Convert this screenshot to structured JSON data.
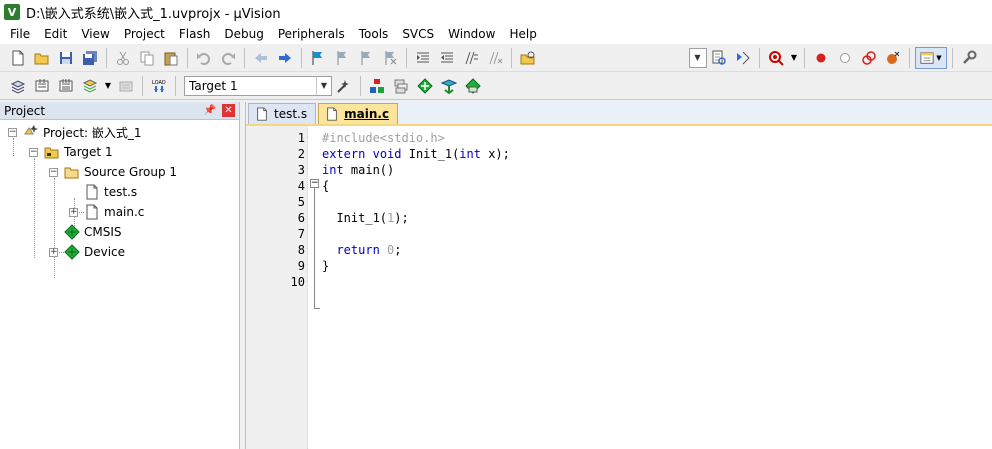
{
  "window": {
    "title": "D:\\嵌入式系统\\嵌入式_1.uvprojx - µVision"
  },
  "menu": [
    "File",
    "Edit",
    "View",
    "Project",
    "Flash",
    "Debug",
    "Peripherals",
    "Tools",
    "SVCS",
    "Window",
    "Help"
  ],
  "toolbar2": {
    "target_label": "Target 1"
  },
  "project_panel": {
    "title": "Project",
    "pin_icon": "pin-icon",
    "close_icon": "close-icon",
    "tree": {
      "root": "Project: 嵌入式_1",
      "target": "Target 1",
      "group": "Source Group 1",
      "file1": "test.s",
      "file2": "main.c",
      "cmsis": "CMSIS",
      "device": "Device"
    }
  },
  "editor": {
    "tabs": [
      {
        "label": "test.s",
        "active": false
      },
      {
        "label": "main.c",
        "active": true
      }
    ],
    "line_numbers": [
      "1",
      "2",
      "3",
      "4",
      "5",
      "6",
      "7",
      "8",
      "9",
      "10"
    ],
    "code": {
      "l1": "#include<stdio.h>",
      "l2_kw1": "extern",
      "l2_kw2": "void",
      "l2_fn": " Init_1(",
      "l2_kw3": "int",
      "l2_end": " x);",
      "l3_kw": "int",
      "l3_rest": " main()",
      "l4": "{",
      "l6_fn": "  Init_1(",
      "l6_num": "1",
      "l6_end": ");",
      "l8_kw": "  return",
      "l8_num": "0",
      "l8_end": ";",
      "l9": "}"
    }
  },
  "colors": {
    "keyword": "#0000c8",
    "preprocessor": "#a0a0a0",
    "active_tab": "#fbe49b",
    "panel_header": "#dbe4ef"
  }
}
